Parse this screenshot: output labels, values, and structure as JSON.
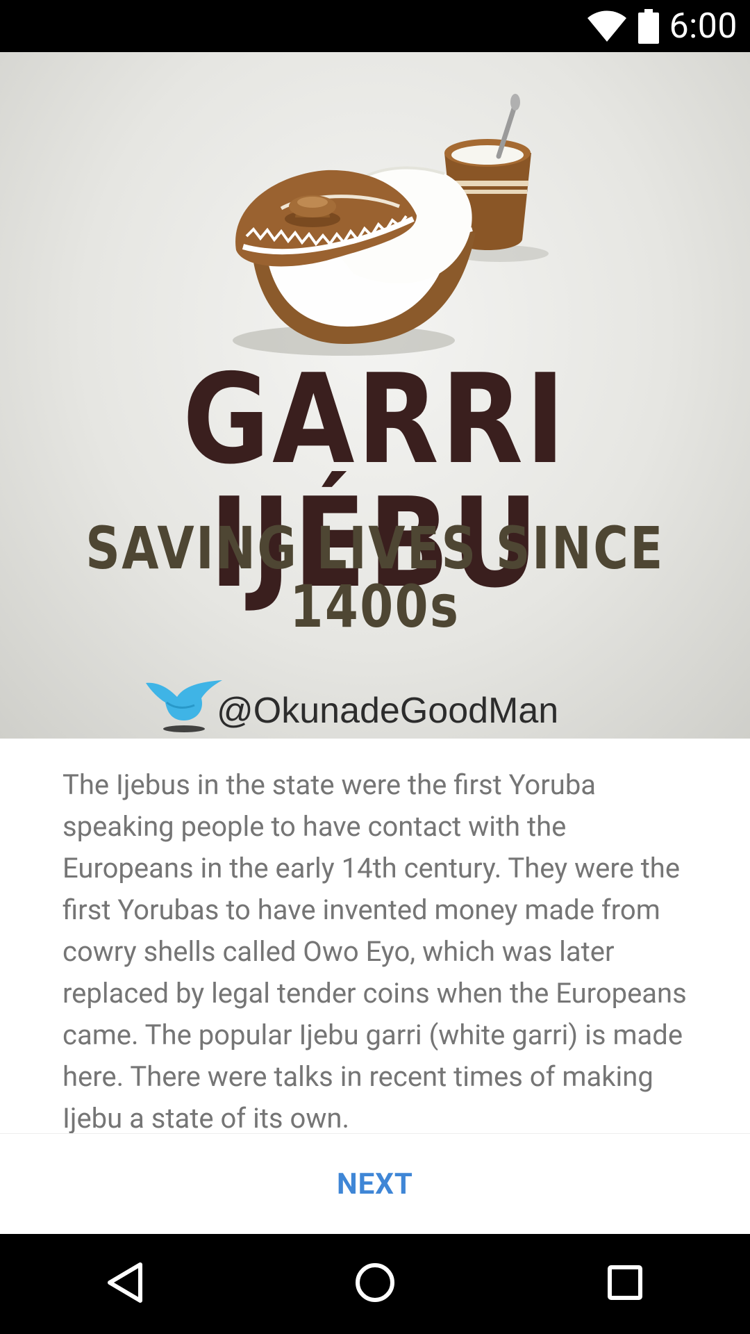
{
  "status_bar": {
    "time": "6:00",
    "icons": [
      "wifi-icon",
      "battery-icon"
    ]
  },
  "hero": {
    "title": "GARRI IJÉBU",
    "subtitle": "SAVING LIVES SINCE 1400s",
    "handle": "@OkunadeGoodMan",
    "icons": [
      "garri-pot-icon",
      "bird-icon"
    ],
    "colors": {
      "title": "#3a1f1e",
      "subtitle": "#4e4633",
      "pot": "#8b5a2b",
      "bird": "#3fb4e6"
    }
  },
  "content": {
    "description": "The Ijebus in the state were the first Yoruba speaking people to have contact with the Europeans in the early 14th century. They were the first Yorubas to have invented money made from cowry shells called Owo Eyo, which was later replaced by legal tender coins when the Europeans came. The popular Ijebu garri (white garri) is made here. There were talks in recent times of making Ijebu a state of its own."
  },
  "footer": {
    "next_label": "NEXT",
    "accent_color": "#3f86d6"
  },
  "nav_bar": {
    "icons": [
      "back-icon",
      "home-icon",
      "recents-icon"
    ]
  }
}
